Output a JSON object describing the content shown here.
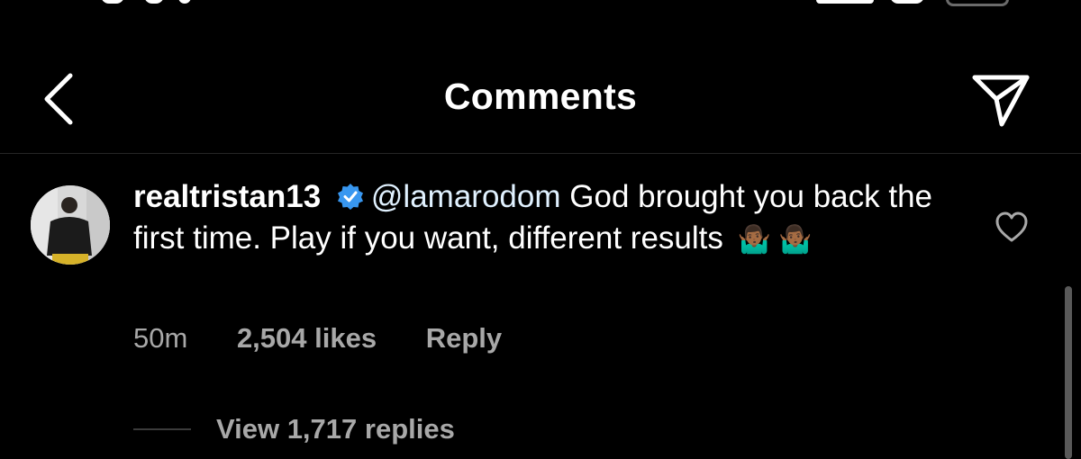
{
  "header": {
    "title": "Comments",
    "back_icon": "chevron-left-icon",
    "share_icon": "paper-plane-icon"
  },
  "comment": {
    "username": "realtristan13",
    "verified": true,
    "mention": "@lamarodom",
    "text": "God brought you back the first time. Play if you want, different results",
    "emojis": "🤷🏾‍♂️ 🤷🏾‍♂️",
    "time": "50m",
    "likes": "2,504 likes",
    "reply_label": "Reply",
    "view_replies": "View 1,717 replies",
    "like_icon": "heart-outline-icon"
  },
  "colors": {
    "background": "#000000",
    "text": "#ffffff",
    "secondary_text": "#a8a8a8",
    "verified_blue": "#3897f0"
  }
}
